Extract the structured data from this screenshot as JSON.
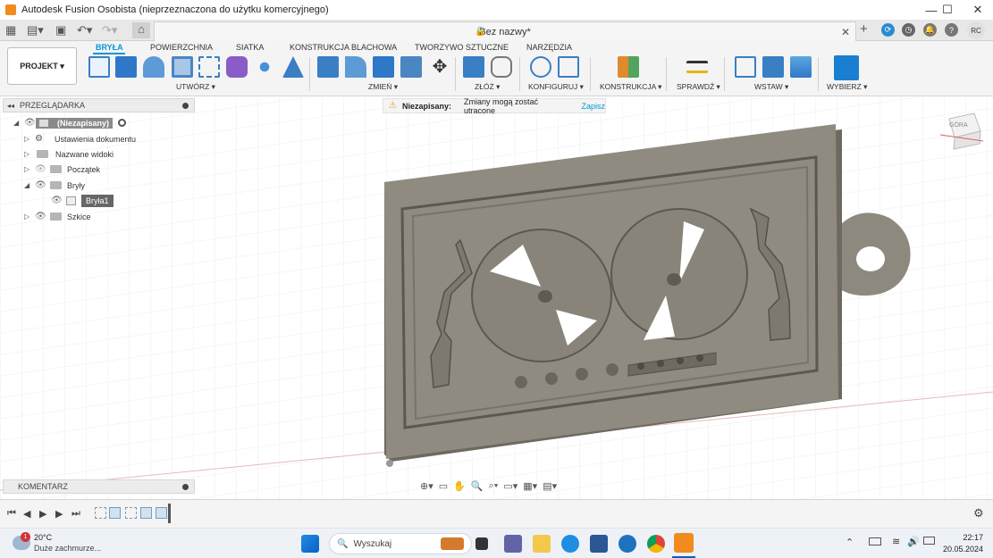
{
  "window": {
    "title": "Autodesk Fusion Osobista (nieprzeznaczona do użytku komercyjnego)",
    "minimize": "—",
    "maximize": "☐",
    "close": "✕"
  },
  "document_tab": {
    "title": "Bez nazwy*",
    "close": "✕"
  },
  "user": {
    "initials": "RC"
  },
  "ribbon": {
    "project_button": "PROJEKT ▾",
    "tabs": [
      "BRYŁA",
      "POWIERZCHNIA",
      "SIATKA",
      "KONSTRUKCJA BLACHOWA",
      "TWORZYWO SZTUCZNE",
      "NARZĘDZIA"
    ],
    "groups": [
      "UTWÓRZ ▾",
      "ZMIEŃ ▾",
      "ZŁÓŻ ▾",
      "KONFIGURUJ ▾",
      "KONSTRUKCJA ▾",
      "SPRAWDŹ ▾",
      "WSTAW ▾",
      "WYBIERZ ▾"
    ]
  },
  "browser": {
    "header": "PRZEGLĄDARKA",
    "root": "(Niezapisany)",
    "items": [
      "Ustawienia dokumentu",
      "Nazwane widoki",
      "Początek",
      "Bryły",
      "Bryła1",
      "Szkice"
    ]
  },
  "warning": {
    "label": "Niezapisany:",
    "message": "Zmiany mogą zostać utracone",
    "action": "Zapisz"
  },
  "viewcube": {
    "label": "GÓRA"
  },
  "comments": {
    "label": "KOMENTARZ"
  },
  "taskbar": {
    "weather_temp": "20°C",
    "weather_desc": "Duże zachmurze...",
    "weather_badge": "1",
    "search_placeholder": "Wyszukaj",
    "time": "22:17",
    "date": "20.05.2024"
  },
  "colors": {
    "accent": "#0696d7",
    "model": "#8f8b80",
    "model_dark": "#6f6b61"
  }
}
